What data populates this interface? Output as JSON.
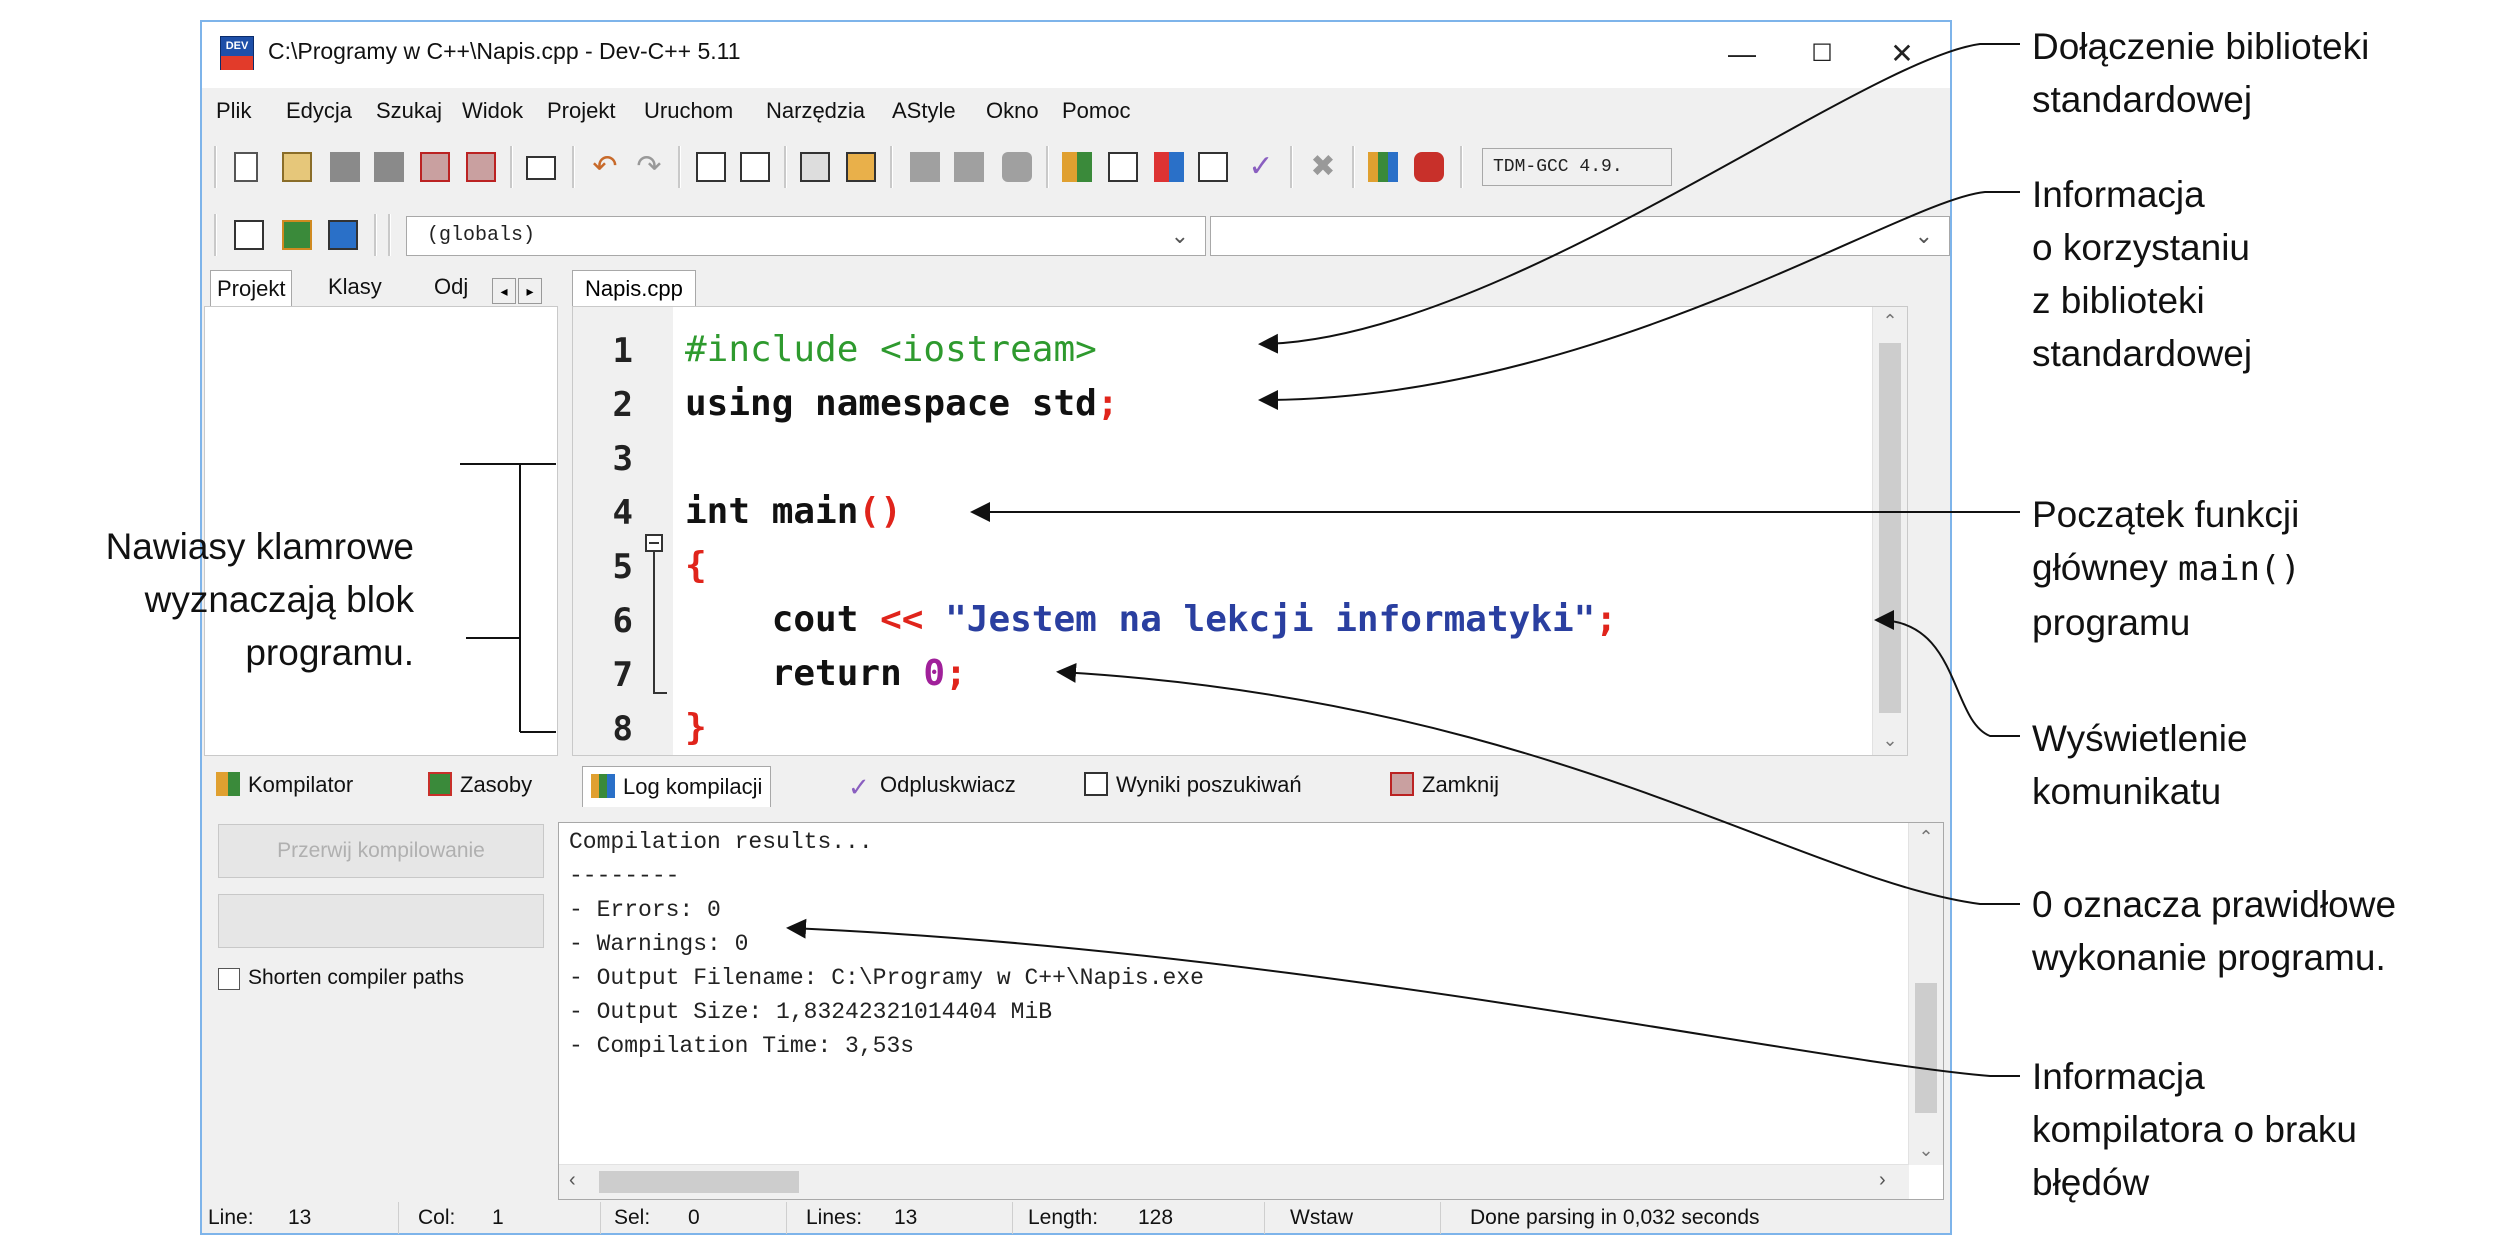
{
  "window": {
    "title": "C:\\Programy w C++\\Napis.cpp - Dev-C++ 5.11",
    "app_icon_text": "DEV",
    "controls": {
      "minimize": "—",
      "maximize": "☐",
      "close": "✕"
    }
  },
  "menu": [
    "Plik",
    "Edycja",
    "Szukaj",
    "Widok",
    "Projekt",
    "Uruchom",
    "Narzędzia",
    "AStyle",
    "Okno",
    "Pomoc"
  ],
  "toolbar": {
    "compiler": "TDM-GCC 4.9.",
    "scope_combo": "(globals)"
  },
  "left_tabs": [
    "Projekt",
    "Klasy",
    "Odj"
  ],
  "editor": {
    "tab": "Napis.cpp",
    "line_numbers": [
      "1",
      "2",
      "3",
      "4",
      "5",
      "6",
      "7",
      "8"
    ]
  },
  "bottom_tabs": [
    "Kompilator",
    "Zasoby",
    "Log kompilacji",
    "Odpluskwiacz",
    "Wyniki poszukiwań",
    "Zamknij"
  ],
  "compile_panel": {
    "abort_button": "Przerwij kompilowanie",
    "shorten_paths_label": "Shorten compiler paths",
    "log_lines": [
      "Compilation results...",
      "--------",
      "- Errors: 0",
      "- Warnings: 0",
      "- Output Filename: C:\\Programy w C++\\Napis.exe",
      "- Output Size: 1,83242321014404 MiB",
      "- Compilation Time: 3,53s"
    ]
  },
  "status": {
    "line_label": "Line:",
    "line_value": "13",
    "col_label": "Col:",
    "col_value": "1",
    "sel_label": "Sel:",
    "sel_value": "0",
    "lines_label": "Lines:",
    "lines_value": "13",
    "length_label": "Length:",
    "length_value": "128",
    "mode": "Wstaw",
    "parse": "Done parsing in 0,032 seconds"
  },
  "callouts": {
    "include": [
      "Dołączenie biblioteki",
      "standardowej"
    ],
    "using": [
      "Informacja",
      "o korzystaniu",
      "z biblioteki",
      "standardowej"
    ],
    "main_a": "Początek funkcji",
    "main_b": "główney ",
    "main_code": "main()",
    "main_c": "programu",
    "cout": [
      "Wyświetlenie",
      "komunikatu"
    ],
    "return": [
      "0 oznacza prawidłowe",
      "wykonanie programu."
    ],
    "errors": [
      "Informacja",
      "kompilatora o braku",
      "błędów"
    ],
    "braces": [
      "Nawiasy klamrowe",
      "wyznaczają blok",
      "programu."
    ]
  },
  "colors": {
    "preprocessor": "#2e9a2e",
    "keyword": "#111111",
    "operator": "#e0241b",
    "string": "#2a3fa0",
    "number": "#a0209a",
    "window_border": "#7eb4ea"
  }
}
